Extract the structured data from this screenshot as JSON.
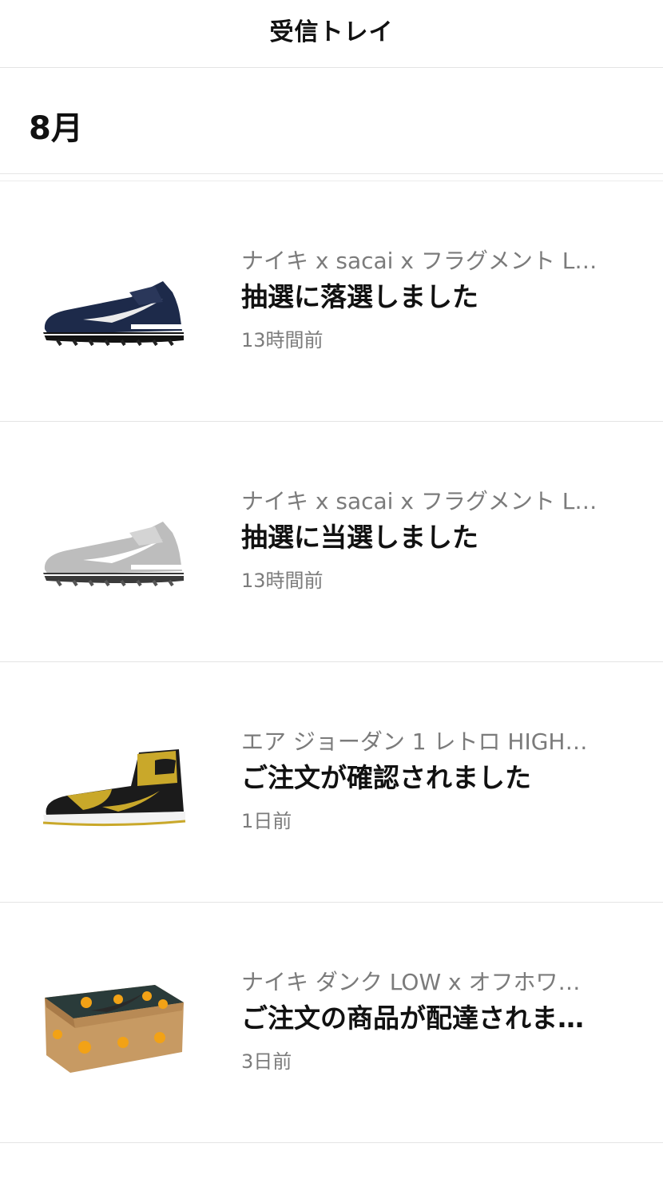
{
  "header": {
    "title": "受信トレイ"
  },
  "section": {
    "month": "8月"
  },
  "notifications": [
    {
      "product": "ナイキ x sacai x フラグメント L…",
      "status": "抽選に落選しました",
      "time": "13時間前",
      "image": "sneaker-navy",
      "colors": {
        "upper": "#1d2a4a",
        "swoosh": "#e9e9e9",
        "sole": "#1a1a1a"
      }
    },
    {
      "product": "ナイキ x sacai x フラグメント L…",
      "status": "抽選に当選しました",
      "time": "13時間前",
      "image": "sneaker-grey",
      "colors": {
        "upper": "#b8b8b8",
        "swoosh": "#ffffff",
        "sole": "#3a3a3a"
      }
    },
    {
      "product": "エア ジョーダン 1 レトロ HIGH…",
      "status": "ご注文が確認されました",
      "time": "1日前",
      "image": "sneaker-yellow-black",
      "colors": {
        "upper": "#c9a82a",
        "accent": "#1b1b1b",
        "sole": "#f2f2f2"
      }
    },
    {
      "product": "ナイキ ダンク LOW x オフホワ…",
      "status": "ご注文の商品が配達されま…",
      "time": "3日前",
      "image": "shoe-box",
      "colors": {
        "box": "#c79a63",
        "dots": "#f2a216",
        "lid": "#2a3b3a"
      }
    }
  ]
}
